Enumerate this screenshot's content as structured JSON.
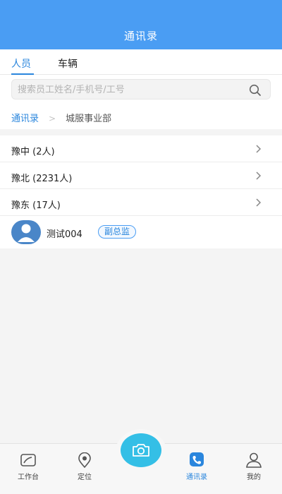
{
  "header": {
    "title": "通讯录"
  },
  "tabs": [
    {
      "label": "人员",
      "active": true
    },
    {
      "label": "车辆",
      "active": false
    }
  ],
  "search": {
    "placeholder": "搜索员工姓名/手机号/工号",
    "value": "",
    "icon": "search-icon"
  },
  "breadcrumb": {
    "root": "通讯录",
    "separator": ">",
    "current": "城服事业部"
  },
  "groups": [
    {
      "label": "豫中 (2人)"
    },
    {
      "label": "豫北 (2231人)"
    },
    {
      "label": "豫东 (17人)"
    }
  ],
  "person": {
    "name": "测试004",
    "badge": "副总监",
    "icon": "avatar-icon"
  },
  "bottom_nav": [
    {
      "label": "工作台",
      "icon": "workbench-icon"
    },
    {
      "label": "定位",
      "icon": "location-pin-icon"
    },
    {
      "label": "",
      "icon": "camera-icon"
    },
    {
      "label": "通讯录",
      "icon": "phone-contacts-icon",
      "active": true
    },
    {
      "label": "我的",
      "icon": "user-profile-icon"
    }
  ],
  "colors": {
    "primary": "#4a9df3",
    "accent": "#2a86dd",
    "camera": "#34bfe6"
  }
}
